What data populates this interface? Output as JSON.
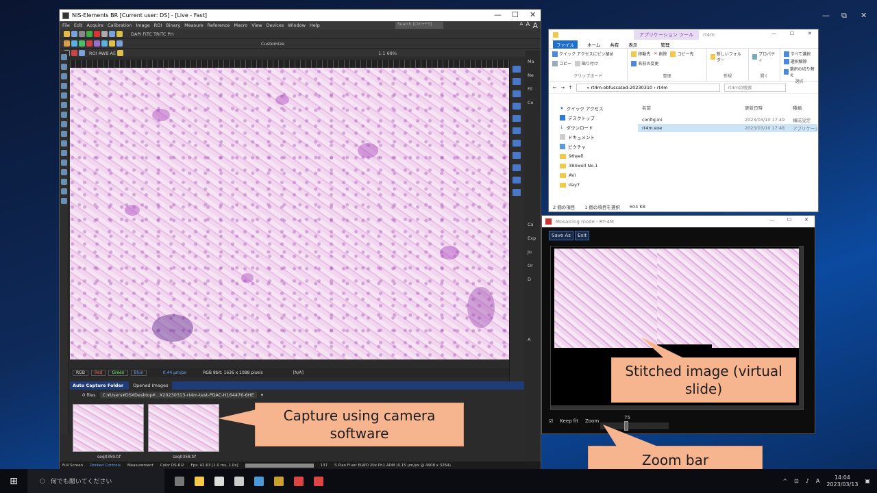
{
  "desktop": {
    "controls": [
      "—",
      "⧉",
      "✕"
    ]
  },
  "nis": {
    "title": "NIS-Elements BR [Current user: DS] - [Live - Fast]",
    "menu": [
      "File",
      "Edit",
      "Acquire",
      "Calibration",
      "Image",
      "ROI",
      "Binary",
      "Measure",
      "Reference",
      "Macro",
      "View",
      "Devices",
      "Window",
      "Help"
    ],
    "search_placeholder": "Search [Ctrl+F3]",
    "text_sizes": [
      "A",
      "A",
      "A"
    ],
    "toolbar1_labels": [
      "DAPI",
      "FITC",
      "TRITC",
      "PH"
    ],
    "customize_label": "Customize",
    "roi_label": "ROI",
    "awb_label": "AWB",
    "ae_label": "AE",
    "zoom_ratio": "1:1",
    "zoom_percent": "68%",
    "right_labels": [
      "Ma",
      "Ne",
      "Fil",
      "Co",
      "Ca",
      "Exp",
      "Ju",
      "Or",
      "D",
      "A"
    ],
    "channel_bar": {
      "channels": [
        "RGB",
        "Red",
        "Green",
        "Blue"
      ],
      "calibration": "0.44 µm/px",
      "format": "RGB 8bit: 1636 x 1088 pixels",
      "na": "[N/A]"
    },
    "capture_panel": {
      "tab_active": "Auto Capture Folder",
      "tab_other": "Opened Images",
      "files_count": "0 files",
      "path": "C:¥Users¥DS¥Desktop¥...¥20230313-rt4m-test-PDAC-H164476-6HE",
      "thumbnails": [
        "seq0359.tif",
        "seq0358.tif"
      ]
    },
    "status": {
      "tabs": [
        "Full Screen",
        "Docked Controls",
        "Measurement",
        "Color DS-Ri2"
      ],
      "fps": "Fps: 42.63 [1.0 ms, 1.0x]",
      "number": "137",
      "objective": "S Plan Fluor ELWD 20x Ph1 ADM (0.15 µm/px @ 4908 x 3264)"
    }
  },
  "explorer": {
    "app_tools": "アプリケーション ツール",
    "folder_title": "rt4m",
    "tabs": [
      "ファイル",
      "ホーム",
      "共有",
      "表示",
      "管理"
    ],
    "ribbon_groups": [
      {
        "label": "クリップボード",
        "items": [
          "クイック アクセスにピン留め",
          "コピー",
          "貼り付け"
        ]
      },
      {
        "label": "整理",
        "items": [
          "移動先",
          "削除",
          "コピー先",
          "名前の変更"
        ]
      },
      {
        "label": "新規",
        "items": [
          "新しいフォルダー"
        ]
      },
      {
        "label": "開く",
        "items": [
          "プロパティ"
        ]
      },
      {
        "label": "選択",
        "items": [
          "すべて選択",
          "選択解除",
          "選択の切り替え"
        ]
      }
    ],
    "address_parts": [
      "rt4m-obfuscated-20230310",
      "rt4m"
    ],
    "search_placeholder": "rt4mの検索",
    "nav": [
      "クイック アクセス",
      "デスクトップ",
      "ダウンロード",
      "ドキュメント",
      "ピクチャ",
      "96well",
      "384well No.1",
      "AVI",
      "day7"
    ],
    "columns": [
      "名前",
      "更新日時",
      "種類"
    ],
    "files": [
      {
        "name": "config.ini",
        "date": "2023/03/10 17:49",
        "type": "構成設定"
      },
      {
        "name": "rt4m.exe",
        "date": "2023/03/10 17:48",
        "type": "アプリケーシ"
      }
    ],
    "status": {
      "count": "2 個の項目",
      "selected": "1 個の項目を選択",
      "size": "604 KB"
    }
  },
  "mosaic": {
    "title": "Mosaicing mode - RT-4M",
    "save_as": "Save As",
    "exit": "Exit",
    "keep_fit": "Keep fit",
    "zoom_label": "Zoom",
    "zoom_value": "75"
  },
  "callouts": {
    "stitched": "Stitched image (virtual slide)",
    "capture": "Capture using camera software",
    "zoom_bar": "Zoom bar"
  },
  "taskbar": {
    "search_placeholder": "何でも聞いてください",
    "time": "14:04",
    "date": "2023/03/13",
    "ime": "A"
  },
  "colors": {
    "accent": "#1e6fcc",
    "callout": "#f7b58f",
    "tissue": "#e9bfe6"
  }
}
